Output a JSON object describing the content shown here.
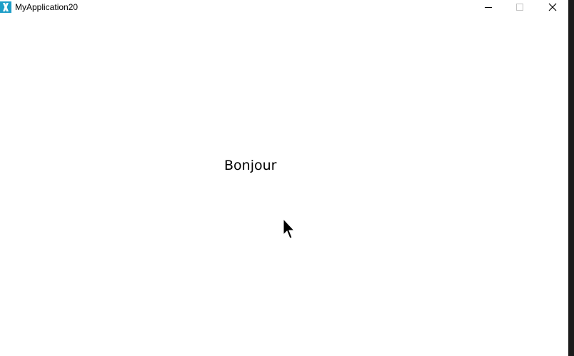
{
  "window": {
    "title": "MyApplication20",
    "app_icon": "xamarin-icon",
    "controls": {
      "minimize_icon": "minimize-icon",
      "maximize_icon": "maximize-icon",
      "close_icon": "close-icon"
    }
  },
  "main": {
    "label": "Bonjour"
  },
  "colors": {
    "icon_background": "#1e9ec7",
    "window_edge": "#1b1b1b",
    "background": "#ffffff",
    "text": "#000000"
  },
  "cursor": {
    "icon": "arrow-cursor-icon"
  }
}
